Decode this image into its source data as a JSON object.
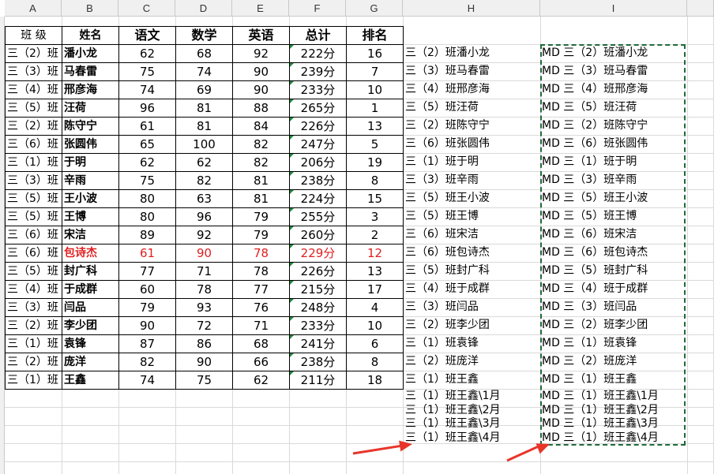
{
  "columns": [
    "A",
    "B",
    "C",
    "D",
    "E",
    "F",
    "G",
    "H",
    "I"
  ],
  "table": {
    "headers": [
      "班 级",
      "姓名",
      "语文",
      "数学",
      "英语",
      "总计",
      "排名"
    ],
    "rows": [
      [
        "三（2）班",
        "潘小龙",
        "62",
        "68",
        "92",
        "222分",
        "16"
      ],
      [
        "三（3）班",
        "马春雷",
        "75",
        "74",
        "90",
        "239分",
        "7"
      ],
      [
        "三（4）班",
        "邢彦海",
        "74",
        "69",
        "90",
        "233分",
        "10"
      ],
      [
        "三（5）班",
        "汪荷",
        "96",
        "81",
        "88",
        "265分",
        "1"
      ],
      [
        "三（2）班",
        "陈守宁",
        "61",
        "81",
        "84",
        "226分",
        "13"
      ],
      [
        "三（6）班",
        "张圆伟",
        "65",
        "100",
        "82",
        "247分",
        "5"
      ],
      [
        "三（1）班",
        "于明",
        "62",
        "62",
        "82",
        "206分",
        "19"
      ],
      [
        "三（3）班",
        "辛雨",
        "75",
        "82",
        "81",
        "238分",
        "8"
      ],
      [
        "三（5）班",
        "王小波",
        "80",
        "63",
        "81",
        "224分",
        "15"
      ],
      [
        "三（5）班",
        "王博",
        "80",
        "96",
        "79",
        "255分",
        "3"
      ],
      [
        "三（6）班",
        "宋洁",
        "89",
        "92",
        "79",
        "260分",
        "2"
      ],
      [
        "三（6）班",
        "包诗杰",
        "61",
        "90",
        "78",
        "229分",
        "12"
      ],
      [
        "三（5）班",
        "封广科",
        "77",
        "71",
        "78",
        "226分",
        "13"
      ],
      [
        "三（4）班",
        "于成群",
        "60",
        "78",
        "77",
        "215分",
        "17"
      ],
      [
        "三（3）班",
        "闫品",
        "79",
        "93",
        "76",
        "248分",
        "4"
      ],
      [
        "三（2）班",
        "李少团",
        "90",
        "72",
        "71",
        "233分",
        "10"
      ],
      [
        "三（1）班",
        "袁锋",
        "87",
        "86",
        "68",
        "241分",
        "6"
      ],
      [
        "三（2）班",
        "庞洋",
        "82",
        "90",
        "66",
        "238分",
        "8"
      ],
      [
        "三（1）班",
        "王鑫",
        "74",
        "75",
        "62",
        "211分",
        "18"
      ]
    ],
    "highlight_row": 11,
    "highlight_color": "#e02020"
  },
  "col_h": [
    "三（2）班潘小龙",
    "三（3）班马春雷",
    "三（4）班邢彦海",
    "三（5）班汪荷",
    "三（2）班陈守宁",
    "三（6）班张圆伟",
    "三（1）班于明",
    "三（3）班辛雨",
    "三（5）班王小波",
    "三（5）班王博",
    "三（6）班宋洁",
    "三（6）班包诗杰",
    "三（5）班封广科",
    "三（4）班于成群",
    "三（3）班闫品",
    "三（2）班李少团",
    "三（1）班袁锋",
    "三（2）班庞洋",
    "三（1）班王鑫"
  ],
  "col_h_extra": [
    "三（1）班王鑫\\1月",
    "三（1）班王鑫\\2月",
    "三（1）班王鑫\\3月",
    "三（1）班王鑫\\4月"
  ],
  "col_i": [
    "MD 三（2）班潘小龙",
    "MD 三（3）班马春雷",
    "MD 三（4）班邢彦海",
    "MD 三（5）班汪荷",
    "MD 三（2）班陈守宁",
    "MD 三（6）班张圆伟",
    "MD 三（1）班于明",
    "MD 三（3）班辛雨",
    "MD 三（5）班王小波",
    "MD 三（5）班王博",
    "MD 三（6）班宋洁",
    "MD 三（6）班包诗杰",
    "MD 三（5）班封广科",
    "MD 三（4）班于成群",
    "MD 三（3）班闫品",
    "MD 三（2）班李少团",
    "MD 三（1）班袁锋",
    "MD 三（2）班庞洋",
    "MD 三（1）班王鑫"
  ],
  "col_i_extra": [
    "MD 三（1）班王鑫\\1月",
    "MD 三（1）班王鑫\\2月",
    "MD 三（1）班王鑫\\3月",
    "MD 三（1）班王鑫\\4月"
  ],
  "colors": {
    "selection_border": "#1e6b3a",
    "arrow": "#e8352a",
    "header_bg": "#f0f0f0"
  }
}
